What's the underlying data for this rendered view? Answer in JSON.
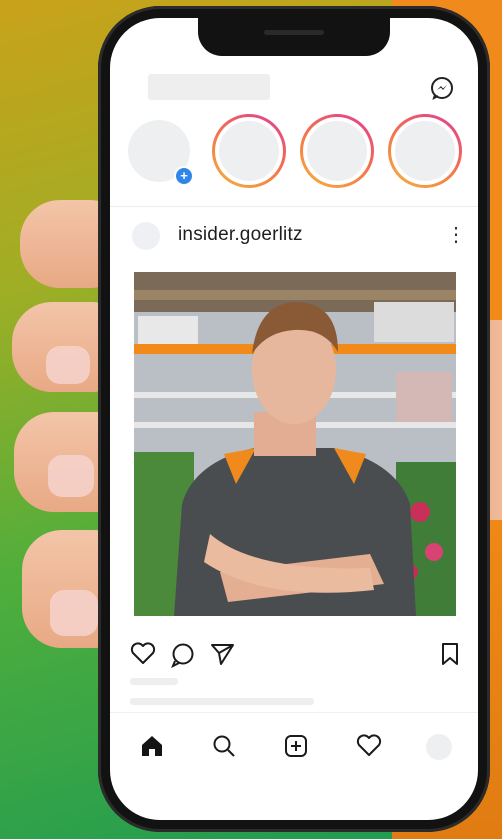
{
  "post": {
    "username": "insider.goerlitz",
    "more_label": "⋮"
  },
  "story": {
    "add_label": "+"
  },
  "icons": {
    "messenger": "messenger-icon",
    "like": "heart-icon",
    "comment": "comment-icon",
    "share": "send-icon",
    "save": "bookmark-icon",
    "nav_home": "home-icon",
    "nav_search": "search-icon",
    "nav_add": "add-post-icon",
    "nav_activity": "heart-icon",
    "nav_profile": "avatar"
  },
  "colors": {
    "story_ring_start": "#e23b93",
    "story_ring_end": "#f5b33d",
    "add_story_blue": "#2f86e8",
    "background_left": "#1d9a52",
    "background_right": "#f08a1c"
  }
}
